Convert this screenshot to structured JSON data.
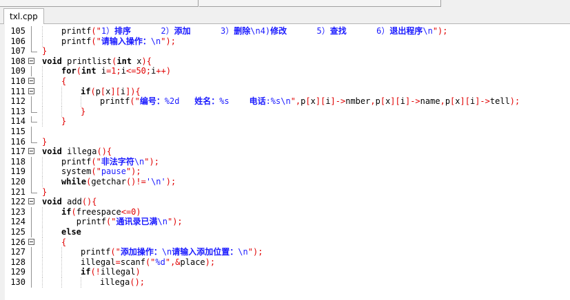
{
  "tabs": [
    {
      "label": "txl.cpp",
      "active": true
    }
  ],
  "lines": [
    {
      "no": "105",
      "fold": "line",
      "indent": 1,
      "tokens": [
        [
          "fn",
          "printf"
        ],
        [
          "op",
          "(\""
        ],
        [
          "str",
          "1）"
        ],
        [
          "strb",
          "排序"
        ],
        [
          "str",
          "      2）"
        ],
        [
          "strb",
          "添加"
        ],
        [
          "str",
          "      3）"
        ],
        [
          "strb",
          "删除"
        ],
        [
          "str",
          "\\n4)"
        ],
        [
          "strb",
          "修改"
        ],
        [
          "str",
          "      5）"
        ],
        [
          "strb",
          "查找"
        ],
        [
          "str",
          "      6）"
        ],
        [
          "strb",
          "退出程序"
        ],
        [
          "str",
          "\\n"
        ],
        [
          "op",
          "\");"
        ]
      ]
    },
    {
      "no": "106",
      "fold": "line",
      "indent": 1,
      "tokens": [
        [
          "fn",
          "printf"
        ],
        [
          "op",
          "(\""
        ],
        [
          "strb",
          "请输入操作："
        ],
        [
          "str",
          "\\n"
        ],
        [
          "op",
          "\");"
        ]
      ]
    },
    {
      "no": "107",
      "fold": "end",
      "indent": 0,
      "tokens": [
        [
          "op",
          "}"
        ]
      ]
    },
    {
      "no": "108",
      "fold": "box",
      "indent": 0,
      "tokens": [
        [
          "kw",
          "void"
        ],
        [
          "fn",
          " printlist"
        ],
        [
          "op",
          "("
        ],
        [
          "kw",
          "int"
        ],
        [
          "fn",
          " x"
        ],
        [
          "op",
          "){"
        ]
      ]
    },
    {
      "no": "109",
      "fold": "line",
      "indent": 1,
      "tokens": [
        [
          "kw",
          "for"
        ],
        [
          "op",
          "("
        ],
        [
          "kw",
          "int"
        ],
        [
          "fn",
          " i"
        ],
        [
          "op",
          "="
        ],
        [
          "num",
          "1"
        ],
        [
          "op",
          ";"
        ],
        [
          "fn",
          "i"
        ],
        [
          "op",
          "<="
        ],
        [
          "num",
          "50"
        ],
        [
          "op",
          ";"
        ],
        [
          "fn",
          "i"
        ],
        [
          "op",
          "++)"
        ]
      ]
    },
    {
      "no": "110",
      "fold": "box",
      "indent": 1,
      "tokens": [
        [
          "op",
          "{"
        ]
      ]
    },
    {
      "no": "111",
      "fold": "box",
      "indent": 2,
      "tokens": [
        [
          "kw",
          "if"
        ],
        [
          "op",
          "("
        ],
        [
          "fn",
          "p"
        ],
        [
          "op",
          "["
        ],
        [
          "fn",
          "x"
        ],
        [
          "op",
          "]["
        ],
        [
          "fn",
          "i"
        ],
        [
          "op",
          "]){"
        ]
      ]
    },
    {
      "no": "112",
      "fold": "line",
      "indent": 3,
      "tokens": [
        [
          "fn",
          "printf"
        ],
        [
          "op",
          "(\""
        ],
        [
          "strb",
          "编号："
        ],
        [
          "str",
          "%2d   "
        ],
        [
          "strb",
          "姓名："
        ],
        [
          "str",
          "%s    "
        ],
        [
          "strb",
          "电话"
        ],
        [
          "str",
          ":%s\\n"
        ],
        [
          "op",
          "\","
        ],
        [
          "fn",
          "p"
        ],
        [
          "op",
          "["
        ],
        [
          "fn",
          "x"
        ],
        [
          "op",
          "]["
        ],
        [
          "fn",
          "i"
        ],
        [
          "op",
          "]->"
        ],
        [
          "fn",
          "nmber"
        ],
        [
          "op",
          ","
        ],
        [
          "fn",
          "p"
        ],
        [
          "op",
          "["
        ],
        [
          "fn",
          "x"
        ],
        [
          "op",
          "]["
        ],
        [
          "fn",
          "i"
        ],
        [
          "op",
          "]->"
        ],
        [
          "fn",
          "name"
        ],
        [
          "op",
          ","
        ],
        [
          "fn",
          "p"
        ],
        [
          "op",
          "["
        ],
        [
          "fn",
          "x"
        ],
        [
          "op",
          "]["
        ],
        [
          "fn",
          "i"
        ],
        [
          "op",
          "]->"
        ],
        [
          "fn",
          "tell"
        ],
        [
          "op",
          ");"
        ]
      ]
    },
    {
      "no": "113",
      "fold": "end",
      "indent": 2,
      "tokens": [
        [
          "op",
          "}"
        ]
      ]
    },
    {
      "no": "114",
      "fold": "end",
      "indent": 1,
      "tokens": [
        [
          "op",
          "}"
        ]
      ]
    },
    {
      "no": "115",
      "fold": "line",
      "indent": 0,
      "tokens": []
    },
    {
      "no": "116",
      "fold": "end",
      "indent": 0,
      "tokens": [
        [
          "op",
          "}"
        ]
      ]
    },
    {
      "no": "117",
      "fold": "box",
      "indent": 0,
      "tokens": [
        [
          "kw",
          "void"
        ],
        [
          "fn",
          " illega"
        ],
        [
          "op",
          "(){"
        ]
      ]
    },
    {
      "no": "118",
      "fold": "line",
      "indent": 1,
      "tokens": [
        [
          "fn",
          "printf"
        ],
        [
          "op",
          "(\""
        ],
        [
          "strb",
          "非法字符"
        ],
        [
          "str",
          "\\n"
        ],
        [
          "op",
          "\");"
        ]
      ]
    },
    {
      "no": "119",
      "fold": "line",
      "indent": 1,
      "tokens": [
        [
          "fn",
          "system"
        ],
        [
          "op",
          "(\""
        ],
        [
          "str",
          "pause"
        ],
        [
          "op",
          "\");"
        ]
      ]
    },
    {
      "no": "120",
      "fold": "line",
      "indent": 1,
      "tokens": [
        [
          "kw",
          "while"
        ],
        [
          "op",
          "("
        ],
        [
          "fn",
          "getchar"
        ],
        [
          "op",
          "()!="
        ],
        [
          "str",
          "'\\n'"
        ],
        [
          "op",
          ");"
        ]
      ]
    },
    {
      "no": "121",
      "fold": "end",
      "indent": 0,
      "tokens": [
        [
          "op",
          "}"
        ]
      ]
    },
    {
      "no": "122",
      "fold": "box",
      "indent": 0,
      "tokens": [
        [
          "kw",
          "void"
        ],
        [
          "fn",
          " add"
        ],
        [
          "op",
          "(){"
        ]
      ]
    },
    {
      "no": "123",
      "fold": "line",
      "indent": 1,
      "tokens": [
        [
          "kw",
          "if"
        ],
        [
          "op",
          "("
        ],
        [
          "fn",
          "freespace"
        ],
        [
          "op",
          "<="
        ],
        [
          "num",
          "0"
        ],
        [
          "op",
          ")"
        ]
      ]
    },
    {
      "no": "124",
      "fold": "line",
      "indent": 1,
      "extra": "   ",
      "tokens": [
        [
          "fn",
          "printf"
        ],
        [
          "op",
          "(\""
        ],
        [
          "strb",
          "通讯录已满"
        ],
        [
          "str",
          "\\n"
        ],
        [
          "op",
          "\");"
        ]
      ]
    },
    {
      "no": "125",
      "fold": "line",
      "indent": 1,
      "tokens": [
        [
          "kw",
          "else"
        ]
      ]
    },
    {
      "no": "126",
      "fold": "box",
      "indent": 1,
      "tokens": [
        [
          "op",
          "{"
        ]
      ]
    },
    {
      "no": "127",
      "fold": "line",
      "indent": 2,
      "tokens": [
        [
          "fn",
          "printf"
        ],
        [
          "op",
          "(\""
        ],
        [
          "strb",
          "添加操作："
        ],
        [
          "str",
          "\\n"
        ],
        [
          "strb",
          "请输入添加位置："
        ],
        [
          "str",
          "\\n"
        ],
        [
          "op",
          "\");"
        ]
      ]
    },
    {
      "no": "128",
      "fold": "line",
      "indent": 2,
      "tokens": [
        [
          "fn",
          "illegal"
        ],
        [
          "op",
          "="
        ],
        [
          "fn",
          "scanf"
        ],
        [
          "op",
          "(\""
        ],
        [
          "str",
          "%d"
        ],
        [
          "op",
          "\",&"
        ],
        [
          "fn",
          "place"
        ],
        [
          "op",
          ");"
        ]
      ]
    },
    {
      "no": "129",
      "fold": "line",
      "indent": 2,
      "tokens": [
        [
          "kw",
          "if"
        ],
        [
          "op",
          "(!"
        ],
        [
          "fn",
          "illegal"
        ],
        [
          "op",
          ")"
        ]
      ]
    },
    {
      "no": "130",
      "fold": "line",
      "indent": 3,
      "tokens": [
        [
          "fn",
          "illega"
        ],
        [
          "op",
          "();"
        ]
      ]
    }
  ]
}
